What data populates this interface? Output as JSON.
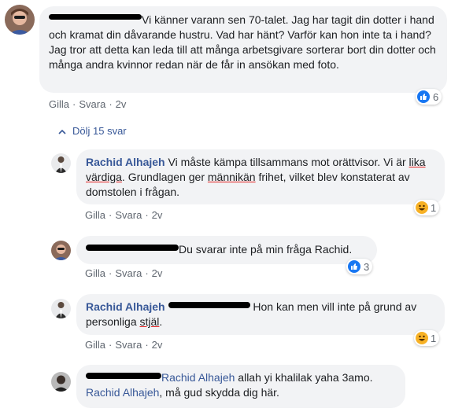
{
  "colors": {
    "link": "#385898",
    "bubble": "#f2f3f5",
    "meta": "#606770",
    "like": "#1877f2",
    "haha": "#f7b125"
  },
  "comment1": {
    "text": "Vi känner varann sen 70-talet. Jag har tagit din dotter i hand och kramat din dåvarande hustru. Vad har hänt? Varför kan hon inte ta i hand? Jag tror att detta kan leda till att många arbetsgivare sorterar bort din dotter och många andra kvinnor redan när de får in ansökan med foto.",
    "like_label": "Gilla",
    "reply_label": "Svara",
    "time": "2v",
    "reaction_icon": "like-icon",
    "reaction_count": "6"
  },
  "toggle": {
    "icon": "chevron-up-icon",
    "label": "Dölj 15 svar"
  },
  "reply1": {
    "author": "Rachid Alhajeh",
    "t1": "Vi måste kämpa tillsammans mot orättvisor. Vi är ",
    "u1": "lika värdiga",
    "t2": ". Grundlagen ger ",
    "u2": "männikän",
    "t3": " frihet, vilket blev konstaterat av domstolen i frågan.",
    "like_label": "Gilla",
    "reply_label": "Svara",
    "time": "2v",
    "reaction_icon": "haha-icon",
    "reaction_count": "1"
  },
  "reply2": {
    "text": "Du svarar inte på min fråga Rachid.",
    "like_label": "Gilla",
    "reply_label": "Svara",
    "time": "2v",
    "reaction_icon": "like-icon",
    "reaction_count": "3"
  },
  "reply3": {
    "author": "Rachid Alhajeh",
    "t1": "Hon kan men vill inte på grund av personliga ",
    "u1": "stjäl",
    "t2": ".",
    "like_label": "Gilla",
    "reply_label": "Svara",
    "time": "2v",
    "reaction_icon": "haha-icon",
    "reaction_count": "1"
  },
  "reply4": {
    "mention1": "Rachid Alhajeh",
    "t1": " allah yi khalilak yaha 3amo.",
    "mention2": "Rachid Alhajeh",
    "t2": ", må gud skydda dig här."
  }
}
